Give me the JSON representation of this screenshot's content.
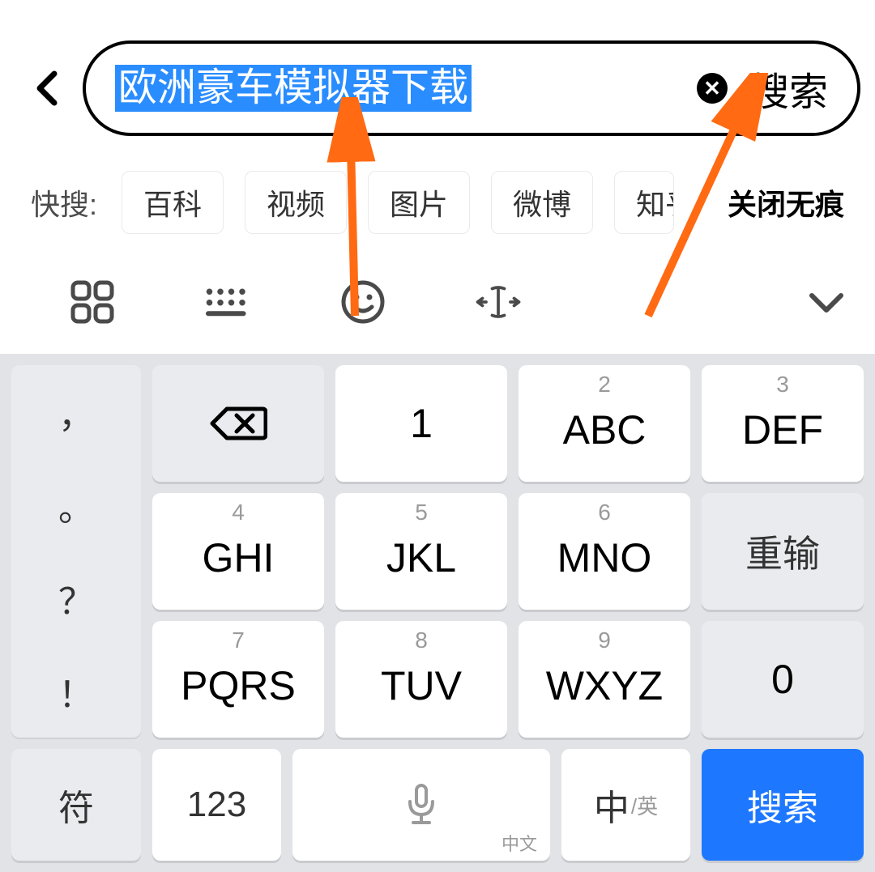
{
  "search": {
    "query": "欧洲豪车模拟器下载",
    "action_label": "搜索"
  },
  "quick": {
    "label": "快搜:",
    "chips": [
      "百科",
      "视频",
      "图片",
      "微博",
      "知乎"
    ],
    "tail": "关闭无痕"
  },
  "keyboard": {
    "side_punct": [
      "，",
      "。",
      "？",
      "！"
    ],
    "keys": [
      {
        "digit": "1",
        "letters": "1"
      },
      {
        "digit": "2",
        "letters": "ABC"
      },
      {
        "digit": "3",
        "letters": "DEF"
      },
      {
        "digit": "4",
        "letters": "GHI"
      },
      {
        "digit": "5",
        "letters": "JKL"
      },
      {
        "digit": "6",
        "letters": "MNO"
      },
      {
        "digit": "7",
        "letters": "PQRS"
      },
      {
        "digit": "8",
        "letters": "TUV"
      },
      {
        "digit": "9",
        "letters": "WXYZ"
      }
    ],
    "right_col": {
      "backspace": "⌫",
      "reinput": "重输",
      "zero": "0"
    },
    "bottom": {
      "symbols": "符",
      "numbers": "123",
      "space_sub": "中文",
      "lang_main": "中",
      "lang_sub": "/英",
      "search": "搜索"
    }
  }
}
